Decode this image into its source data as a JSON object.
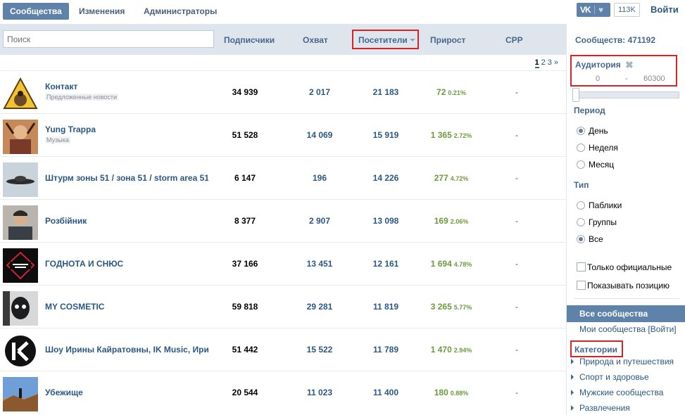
{
  "nav": {
    "tabs": [
      {
        "label": "Сообщества",
        "active": true
      },
      {
        "label": "Изменения",
        "active": false
      },
      {
        "label": "Администраторы",
        "active": false
      }
    ],
    "like_count": "113K",
    "login_label": "Войти",
    "vk_logo_text": "VK"
  },
  "table": {
    "search_placeholder": "Поиск",
    "columns": {
      "subscribers": "Подписчики",
      "reach": "Охват",
      "visitors": "Посетители",
      "growth": "Прирост",
      "cpp": "CPP"
    },
    "pager": {
      "current": "1",
      "pages": [
        "2",
        "3"
      ],
      "next": "»"
    },
    "rows": [
      {
        "name": "Контакт",
        "category": "Предложенные новости",
        "subscribers": "34 939",
        "reach": "2 017",
        "visitors": "21 183",
        "growth": "72",
        "growth_pct": "0.21%",
        "cpp": "-"
      },
      {
        "name": "Yung Trappa",
        "category": "Музыка",
        "subscribers": "51 528",
        "reach": "14 069",
        "visitors": "15 919",
        "growth": "1 365",
        "growth_pct": "2.72%",
        "cpp": "-"
      },
      {
        "name": "Штурм зоны 51 / зона 51 / storm area 51",
        "category": "",
        "subscribers": "6 147",
        "reach": "196",
        "visitors": "14 226",
        "growth": "277",
        "growth_pct": "4.72%",
        "cpp": "-"
      },
      {
        "name": "Розбійник",
        "category": "",
        "subscribers": "8 377",
        "reach": "2 907",
        "visitors": "13 098",
        "growth": "169",
        "growth_pct": "2.06%",
        "cpp": "-"
      },
      {
        "name": "ГОДНОТА И СНЮС",
        "category": "",
        "subscribers": "37 166",
        "reach": "13 451",
        "visitors": "12 161",
        "growth": "1 694",
        "growth_pct": "4.78%",
        "cpp": "-"
      },
      {
        "name": "MY COSMETIC",
        "category": "",
        "subscribers": "59 818",
        "reach": "29 281",
        "visitors": "11 819",
        "growth": "3 265",
        "growth_pct": "5.77%",
        "cpp": "-"
      },
      {
        "name": "Шоу Ирины Кайратовны, IK Music, Ири",
        "category": "",
        "subscribers": "51 442",
        "reach": "15 522",
        "visitors": "11 789",
        "growth": "1 470",
        "growth_pct": "2.94%",
        "cpp": "-"
      },
      {
        "name": "Убежище",
        "category": "",
        "subscribers": "20 544",
        "reach": "11 023",
        "visitors": "11 400",
        "growth": "180",
        "growth_pct": "0.88%",
        "cpp": "-"
      }
    ]
  },
  "sidebar": {
    "total_label": "Сообществ: 471192",
    "audience": {
      "title": "Аудитория",
      "min": "0",
      "dash": "-",
      "max": "60300",
      "slider_position": 0
    },
    "period": {
      "title": "Период",
      "options": [
        "День",
        "Неделя",
        "Месяц"
      ],
      "selected": "День"
    },
    "type": {
      "title": "Тип",
      "options": [
        "Паблики",
        "Группы",
        "Все"
      ],
      "selected": "Все"
    },
    "checkboxes": [
      "Только официальные",
      "Показывать позицию"
    ],
    "all_communities": "Все сообщества",
    "my_communities": "Мои сообщества [Войти]",
    "categories_title": "Категории",
    "categories": [
      "Природа и путешествия",
      "Спорт и здоровье",
      "Мужские сообщества",
      "Развлечения"
    ]
  },
  "colors": {
    "accent": "#5e82a8",
    "link": "#2a5885",
    "growth": "#6c9a3e",
    "highlight_border": "#d92323"
  }
}
